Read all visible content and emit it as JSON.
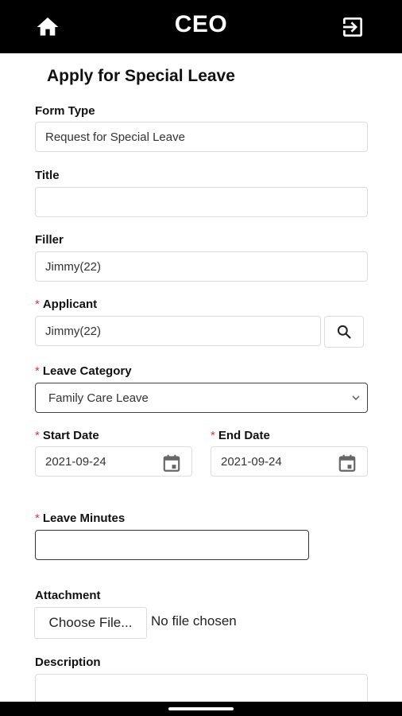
{
  "header": {
    "title": "CEO",
    "home_icon": "home-icon",
    "logout_icon": "logout-icon"
  },
  "page": {
    "title": "Apply for Special Leave"
  },
  "form": {
    "form_type": {
      "label": "Form Type",
      "value": "Request for Special Leave"
    },
    "title": {
      "label": "Title",
      "value": ""
    },
    "filler": {
      "label": "Filler",
      "value": "Jimmy(22)"
    },
    "applicant": {
      "label": "Applicant",
      "value": "Jimmy(22)",
      "search_icon": "search-icon"
    },
    "leave_category": {
      "label": "Leave Category",
      "value": "Family Care Leave"
    },
    "start_date": {
      "label": "Start Date",
      "value": "2021-09-24"
    },
    "end_date": {
      "label": "End Date",
      "value": "2021-09-24"
    },
    "leave_minutes": {
      "label": "Leave Minutes",
      "value": ""
    },
    "attachment": {
      "label": "Attachment",
      "button": "Choose File...",
      "status": "No file chosen"
    },
    "description": {
      "label": "Description",
      "value": ""
    },
    "required_mark": "*"
  },
  "colors": {
    "topbar": "#000000",
    "required": "#d9363e"
  }
}
